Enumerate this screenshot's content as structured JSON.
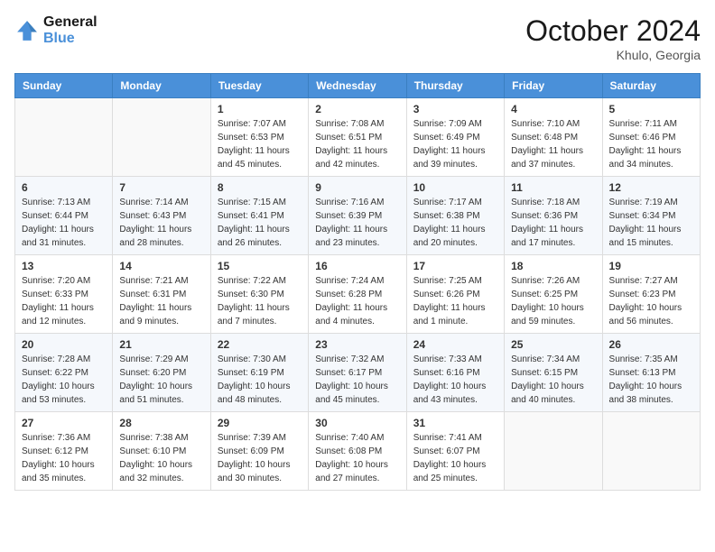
{
  "header": {
    "logo_line1": "General",
    "logo_line2": "Blue",
    "month_title": "October 2024",
    "location": "Khulo, Georgia"
  },
  "weekdays": [
    "Sunday",
    "Monday",
    "Tuesday",
    "Wednesday",
    "Thursday",
    "Friday",
    "Saturday"
  ],
  "weeks": [
    [
      {
        "day": "",
        "sunrise": "",
        "sunset": "",
        "daylight": ""
      },
      {
        "day": "",
        "sunrise": "",
        "sunset": "",
        "daylight": ""
      },
      {
        "day": "1",
        "sunrise": "Sunrise: 7:07 AM",
        "sunset": "Sunset: 6:53 PM",
        "daylight": "Daylight: 11 hours and 45 minutes."
      },
      {
        "day": "2",
        "sunrise": "Sunrise: 7:08 AM",
        "sunset": "Sunset: 6:51 PM",
        "daylight": "Daylight: 11 hours and 42 minutes."
      },
      {
        "day": "3",
        "sunrise": "Sunrise: 7:09 AM",
        "sunset": "Sunset: 6:49 PM",
        "daylight": "Daylight: 11 hours and 39 minutes."
      },
      {
        "day": "4",
        "sunrise": "Sunrise: 7:10 AM",
        "sunset": "Sunset: 6:48 PM",
        "daylight": "Daylight: 11 hours and 37 minutes."
      },
      {
        "day": "5",
        "sunrise": "Sunrise: 7:11 AM",
        "sunset": "Sunset: 6:46 PM",
        "daylight": "Daylight: 11 hours and 34 minutes."
      }
    ],
    [
      {
        "day": "6",
        "sunrise": "Sunrise: 7:13 AM",
        "sunset": "Sunset: 6:44 PM",
        "daylight": "Daylight: 11 hours and 31 minutes."
      },
      {
        "day": "7",
        "sunrise": "Sunrise: 7:14 AM",
        "sunset": "Sunset: 6:43 PM",
        "daylight": "Daylight: 11 hours and 28 minutes."
      },
      {
        "day": "8",
        "sunrise": "Sunrise: 7:15 AM",
        "sunset": "Sunset: 6:41 PM",
        "daylight": "Daylight: 11 hours and 26 minutes."
      },
      {
        "day": "9",
        "sunrise": "Sunrise: 7:16 AM",
        "sunset": "Sunset: 6:39 PM",
        "daylight": "Daylight: 11 hours and 23 minutes."
      },
      {
        "day": "10",
        "sunrise": "Sunrise: 7:17 AM",
        "sunset": "Sunset: 6:38 PM",
        "daylight": "Daylight: 11 hours and 20 minutes."
      },
      {
        "day": "11",
        "sunrise": "Sunrise: 7:18 AM",
        "sunset": "Sunset: 6:36 PM",
        "daylight": "Daylight: 11 hours and 17 minutes."
      },
      {
        "day": "12",
        "sunrise": "Sunrise: 7:19 AM",
        "sunset": "Sunset: 6:34 PM",
        "daylight": "Daylight: 11 hours and 15 minutes."
      }
    ],
    [
      {
        "day": "13",
        "sunrise": "Sunrise: 7:20 AM",
        "sunset": "Sunset: 6:33 PM",
        "daylight": "Daylight: 11 hours and 12 minutes."
      },
      {
        "day": "14",
        "sunrise": "Sunrise: 7:21 AM",
        "sunset": "Sunset: 6:31 PM",
        "daylight": "Daylight: 11 hours and 9 minutes."
      },
      {
        "day": "15",
        "sunrise": "Sunrise: 7:22 AM",
        "sunset": "Sunset: 6:30 PM",
        "daylight": "Daylight: 11 hours and 7 minutes."
      },
      {
        "day": "16",
        "sunrise": "Sunrise: 7:24 AM",
        "sunset": "Sunset: 6:28 PM",
        "daylight": "Daylight: 11 hours and 4 minutes."
      },
      {
        "day": "17",
        "sunrise": "Sunrise: 7:25 AM",
        "sunset": "Sunset: 6:26 PM",
        "daylight": "Daylight: 11 hours and 1 minute."
      },
      {
        "day": "18",
        "sunrise": "Sunrise: 7:26 AM",
        "sunset": "Sunset: 6:25 PM",
        "daylight": "Daylight: 10 hours and 59 minutes."
      },
      {
        "day": "19",
        "sunrise": "Sunrise: 7:27 AM",
        "sunset": "Sunset: 6:23 PM",
        "daylight": "Daylight: 10 hours and 56 minutes."
      }
    ],
    [
      {
        "day": "20",
        "sunrise": "Sunrise: 7:28 AM",
        "sunset": "Sunset: 6:22 PM",
        "daylight": "Daylight: 10 hours and 53 minutes."
      },
      {
        "day": "21",
        "sunrise": "Sunrise: 7:29 AM",
        "sunset": "Sunset: 6:20 PM",
        "daylight": "Daylight: 10 hours and 51 minutes."
      },
      {
        "day": "22",
        "sunrise": "Sunrise: 7:30 AM",
        "sunset": "Sunset: 6:19 PM",
        "daylight": "Daylight: 10 hours and 48 minutes."
      },
      {
        "day": "23",
        "sunrise": "Sunrise: 7:32 AM",
        "sunset": "Sunset: 6:17 PM",
        "daylight": "Daylight: 10 hours and 45 minutes."
      },
      {
        "day": "24",
        "sunrise": "Sunrise: 7:33 AM",
        "sunset": "Sunset: 6:16 PM",
        "daylight": "Daylight: 10 hours and 43 minutes."
      },
      {
        "day": "25",
        "sunrise": "Sunrise: 7:34 AM",
        "sunset": "Sunset: 6:15 PM",
        "daylight": "Daylight: 10 hours and 40 minutes."
      },
      {
        "day": "26",
        "sunrise": "Sunrise: 7:35 AM",
        "sunset": "Sunset: 6:13 PM",
        "daylight": "Daylight: 10 hours and 38 minutes."
      }
    ],
    [
      {
        "day": "27",
        "sunrise": "Sunrise: 7:36 AM",
        "sunset": "Sunset: 6:12 PM",
        "daylight": "Daylight: 10 hours and 35 minutes."
      },
      {
        "day": "28",
        "sunrise": "Sunrise: 7:38 AM",
        "sunset": "Sunset: 6:10 PM",
        "daylight": "Daylight: 10 hours and 32 minutes."
      },
      {
        "day": "29",
        "sunrise": "Sunrise: 7:39 AM",
        "sunset": "Sunset: 6:09 PM",
        "daylight": "Daylight: 10 hours and 30 minutes."
      },
      {
        "day": "30",
        "sunrise": "Sunrise: 7:40 AM",
        "sunset": "Sunset: 6:08 PM",
        "daylight": "Daylight: 10 hours and 27 minutes."
      },
      {
        "day": "31",
        "sunrise": "Sunrise: 7:41 AM",
        "sunset": "Sunset: 6:07 PM",
        "daylight": "Daylight: 10 hours and 25 minutes."
      },
      {
        "day": "",
        "sunrise": "",
        "sunset": "",
        "daylight": ""
      },
      {
        "day": "",
        "sunrise": "",
        "sunset": "",
        "daylight": ""
      }
    ]
  ]
}
